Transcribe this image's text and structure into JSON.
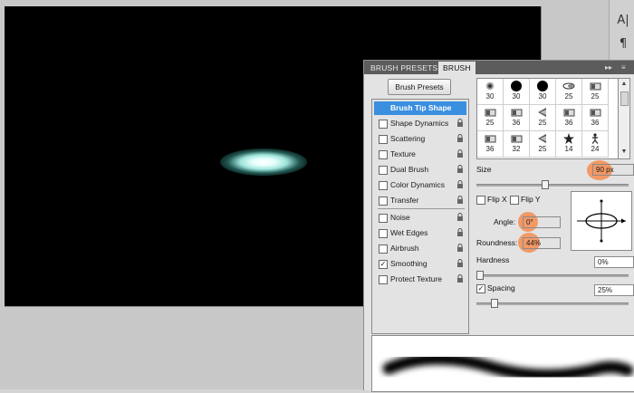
{
  "panel": {
    "tabs": [
      {
        "label": "BRUSH PRESETS",
        "active": false
      },
      {
        "label": "BRUSH",
        "active": true
      }
    ],
    "menu_glyph": "▸▸",
    "menu_lines_glyph": "≡"
  },
  "strip": {
    "char_icon": "A|",
    "para_icon": "¶"
  },
  "presets_button": "Brush Presets",
  "tip_options": [
    {
      "label": "Brush Tip Shape",
      "checked": null,
      "selected": true,
      "lock": false
    },
    {
      "label": "Shape Dynamics",
      "checked": false,
      "selected": false,
      "lock": true
    },
    {
      "label": "Scattering",
      "checked": false,
      "selected": false,
      "lock": true
    },
    {
      "label": "Texture",
      "checked": false,
      "selected": false,
      "lock": true
    },
    {
      "label": "Dual Brush",
      "checked": false,
      "selected": false,
      "lock": true
    },
    {
      "label": "Color Dynamics",
      "checked": false,
      "selected": false,
      "lock": true
    },
    {
      "label": "Transfer",
      "checked": false,
      "selected": false,
      "lock": true
    },
    {
      "label": "Noise",
      "checked": false,
      "selected": false,
      "lock": true
    },
    {
      "label": "Wet Edges",
      "checked": false,
      "selected": false,
      "lock": true
    },
    {
      "label": "Airbrush",
      "checked": false,
      "selected": false,
      "lock": true
    },
    {
      "label": "Smoothing",
      "checked": true,
      "selected": false,
      "lock": true
    },
    {
      "label": "Protect Texture",
      "checked": false,
      "selected": false,
      "lock": true
    }
  ],
  "brush_grid": [
    {
      "size": "30",
      "shape": "soft-dot"
    },
    {
      "size": "30",
      "shape": "hard-dot-lg"
    },
    {
      "size": "30",
      "shape": "hard-dot-lg"
    },
    {
      "size": "25",
      "shape": "ellipse"
    },
    {
      "size": "25",
      "shape": "bristle"
    },
    {
      "size": "25",
      "shape": "bristle"
    },
    {
      "size": "36",
      "shape": "bristle"
    },
    {
      "size": "25",
      "shape": "fan"
    },
    {
      "size": "36",
      "shape": "bristle"
    },
    {
      "size": "36",
      "shape": "bristle"
    },
    {
      "size": "36",
      "shape": "bristle"
    },
    {
      "size": "32",
      "shape": "bristle"
    },
    {
      "size": "25",
      "shape": "fan"
    },
    {
      "size": "14",
      "shape": "star"
    },
    {
      "size": "24",
      "shape": "figure"
    }
  ],
  "size": {
    "label": "Size",
    "value": "90 px",
    "slider_fraction": 0.45
  },
  "flip_x": {
    "label": "Flip X",
    "checked": false
  },
  "flip_y": {
    "label": "Flip Y",
    "checked": false
  },
  "angle": {
    "label": "Angle:",
    "value": "0°"
  },
  "roundness": {
    "label": "Roundness:",
    "value": "44%"
  },
  "hardness": {
    "label": "Hardness",
    "value": "0%",
    "slider_fraction": 0.0
  },
  "spacing": {
    "label": "Spacing",
    "value": "25%",
    "checked": true,
    "slider_fraction": 0.1
  },
  "glyphs": {
    "check": "✓",
    "lock": "🔒",
    "up": "▲",
    "down": "▼"
  },
  "colors": {
    "highlight": "#f48c50",
    "selected": "#3b8fe0",
    "canvas": "#000000"
  }
}
